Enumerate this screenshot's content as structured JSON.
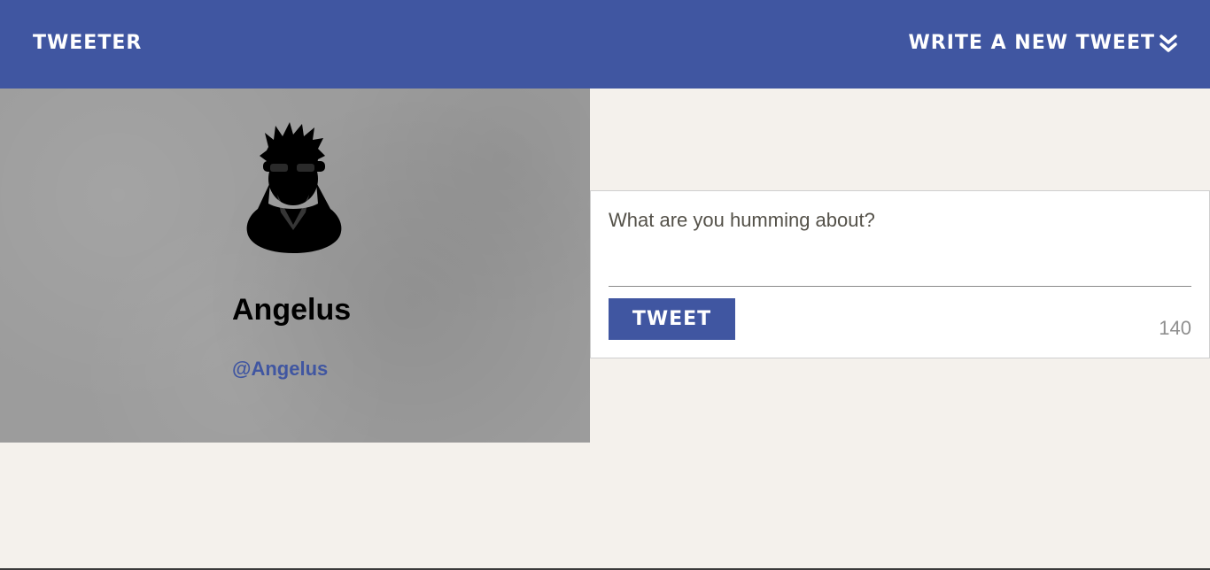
{
  "nav": {
    "brand": "Tweeter",
    "compose_label": "Write a new tweet",
    "compose_icon": "double-chevron-down-icon"
  },
  "profile": {
    "avatar_icon": "user-avatar-icon",
    "name": "Angelus",
    "handle": "@Angelus"
  },
  "composer": {
    "placeholder": "What are you humming about?",
    "value": "",
    "submit_label": "Tweet",
    "char_count": "140"
  },
  "colors": {
    "brand_blue": "#4056a1",
    "page_background": "#f4f1ec",
    "profile_background": "#9c9c9c",
    "counter_text": "#8f8f8f"
  }
}
